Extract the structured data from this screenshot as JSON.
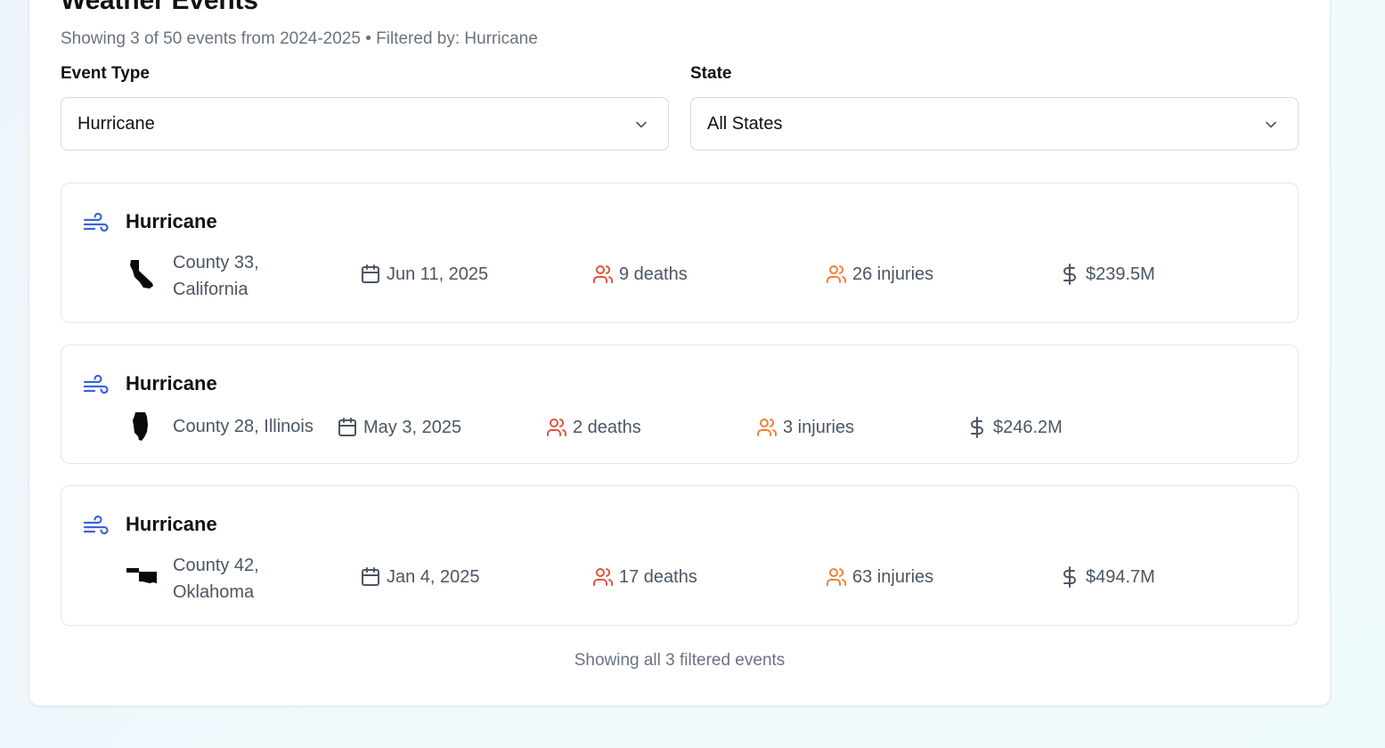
{
  "header": {
    "title": "Weather Events",
    "subtitle": "Showing 3 of 50 events from 2024-2025 • Filtered by: Hurricane"
  },
  "filters": {
    "event_type": {
      "label": "Event Type",
      "value": "Hurricane"
    },
    "state": {
      "label": "State",
      "value": "All States"
    }
  },
  "events": [
    {
      "type": "Hurricane",
      "icon": "wind-icon",
      "state_icon": "california-shape-icon",
      "location": "County 33, California",
      "location_line1": "County 33,",
      "location_line2": "California",
      "date": "Jun 11, 2025",
      "deaths": "9 deaths",
      "injuries": "26 injuries",
      "damage": "$239.5M"
    },
    {
      "type": "Hurricane",
      "icon": "wind-icon",
      "state_icon": "illinois-shape-icon",
      "location": "County 28, Illinois",
      "date": "May 3, 2025",
      "deaths": "2 deaths",
      "injuries": "3 injuries",
      "damage": "$246.2M"
    },
    {
      "type": "Hurricane",
      "icon": "wind-icon",
      "state_icon": "oklahoma-shape-icon",
      "location": "County 42, Oklahoma",
      "location_line1": "County 42,",
      "location_line2": "Oklahoma",
      "date": "Jan 4, 2025",
      "deaths": "17 deaths",
      "injuries": "63 injuries",
      "damage": "$494.7M"
    }
  ],
  "footer": {
    "text": "Showing all 3 filtered events"
  },
  "colors": {
    "wind_icon": "#3b63d8",
    "deaths_icon": "#e0533e",
    "injuries_icon": "#f0813a",
    "meta_icon": "#4b5563"
  }
}
